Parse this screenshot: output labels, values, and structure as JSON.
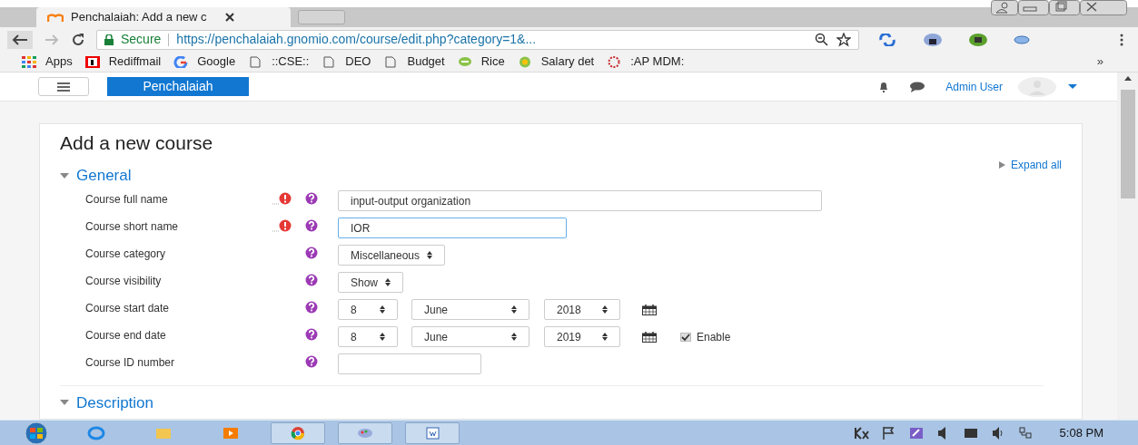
{
  "browser": {
    "tab": {
      "title": "Penchalaiah: Add a new c"
    },
    "address": {
      "secure_label": "Secure",
      "url": "https://penchalaiah.gnomio.com/course/edit.php?category=1&..."
    },
    "bookmarks": [
      {
        "label": "Apps",
        "kind": "apps"
      },
      {
        "label": "Rediffmail",
        "kind": "rediff"
      },
      {
        "label": "Google",
        "kind": "google"
      },
      {
        "label": "::CSE::",
        "kind": "page"
      },
      {
        "label": "DEO",
        "kind": "page"
      },
      {
        "label": "Budget",
        "kind": "page"
      },
      {
        "label": "Rice",
        "kind": "leaf"
      },
      {
        "label": "Salary det",
        "kind": "globe"
      },
      {
        "label": ":AP MDM:",
        "kind": "emblem"
      }
    ],
    "more": "»"
  },
  "navbar": {
    "brand": "Penchalaiah",
    "user": "Admin User"
  },
  "page": {
    "title": "Add a new course",
    "expand_all": "Expand all",
    "sections": [
      {
        "title": "General",
        "expanded": true,
        "fields": [
          {
            "kind": "text",
            "label": "Course full name",
            "required": true,
            "value": "input-output organization",
            "focused": false
          },
          {
            "kind": "text",
            "label": "Course short name",
            "required": true,
            "value": "IOR",
            "focused": true
          },
          {
            "kind": "select",
            "label": "Course category",
            "required": false,
            "value": "Miscellaneous"
          },
          {
            "kind": "select",
            "label": "Course visibility",
            "required": false,
            "value": "Show"
          },
          {
            "kind": "date",
            "label": "Course start date",
            "required": false,
            "day": "8",
            "month": "June",
            "year": "2018"
          },
          {
            "kind": "date",
            "label": "Course end date",
            "required": false,
            "day": "8",
            "month": "June",
            "year": "2019",
            "enable": {
              "label": "Enable",
              "checked": true
            }
          },
          {
            "kind": "text",
            "label": "Course ID number",
            "required": false,
            "focused": false
          }
        ]
      },
      {
        "title": "Description",
        "expanded": true
      }
    ]
  },
  "taskbar": {
    "time": "5:08 PM"
  }
}
